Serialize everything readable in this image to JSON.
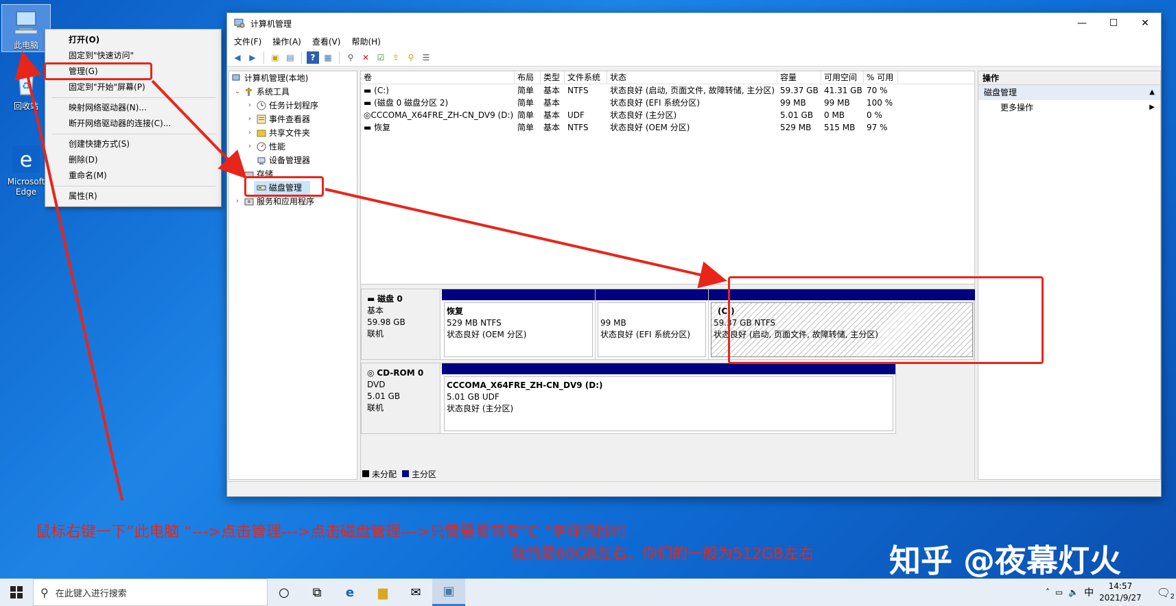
{
  "desktop": {
    "icons": [
      {
        "label": "此电脑"
      },
      {
        "label": "回收站"
      },
      {
        "label": "Microsoft Edge"
      }
    ]
  },
  "context_menu": {
    "items": [
      {
        "label": "打开(O)"
      },
      {
        "label": "固定到\"快速访问\""
      },
      {
        "label": "管理(G)"
      },
      {
        "label": "固定到\"开始\"屏幕(P)"
      },
      {
        "label": "映射网络驱动器(N)..."
      },
      {
        "label": "断开网络驱动器的连接(C)..."
      },
      {
        "label": "创建快捷方式(S)"
      },
      {
        "label": "删除(D)"
      },
      {
        "label": "重命名(M)"
      },
      {
        "label": "属性(R)"
      }
    ]
  },
  "window": {
    "title": "计算机管理",
    "controls": {
      "minimize": "—",
      "maximize": "☐",
      "close": "✕"
    },
    "menu": [
      "文件(F)",
      "操作(A)",
      "查看(V)",
      "帮助(H)"
    ]
  },
  "tree": {
    "root": "计算机管理(本地)",
    "system_tools": "系统工具",
    "task_scheduler": "任务计划程序",
    "event_viewer": "事件查看器",
    "shared_folders": "共享文件夹",
    "performance": "性能",
    "device_manager": "设备管理器",
    "storage": "存储",
    "disk_management": "磁盘管理",
    "services": "服务和应用程序"
  },
  "volume_table": {
    "headers": [
      "卷",
      "布局",
      "类型",
      "文件系统",
      "状态",
      "容量",
      "可用空间",
      "% 可用"
    ],
    "rows": [
      [
        "(C:)",
        "简单",
        "基本",
        "NTFS",
        "状态良好 (启动, 页面文件, 故障转储, 主分区)",
        "59.37 GB",
        "41.31 GB",
        "70 %"
      ],
      [
        "(磁盘 0 磁盘分区 2)",
        "简单",
        "基本",
        "",
        "状态良好 (EFI 系统分区)",
        "99 MB",
        "99 MB",
        "100 %"
      ],
      [
        "CCCOMA_X64FRE_ZH-CN_DV9 (D:)",
        "简单",
        "基本",
        "UDF",
        "状态良好 (主分区)",
        "5.01 GB",
        "0 MB",
        "0 %"
      ],
      [
        "恢复",
        "简单",
        "基本",
        "NTFS",
        "状态良好 (OEM 分区)",
        "529 MB",
        "515 MB",
        "97 %"
      ]
    ]
  },
  "disks": {
    "disk0": {
      "name": "磁盘 0",
      "type": "基本",
      "size": "59.98 GB",
      "status": "联机",
      "partitions": [
        {
          "name": "恢复",
          "size": "529 MB NTFS",
          "status": "状态良好 (OEM 分区)"
        },
        {
          "name": "",
          "size": "99 MB",
          "status": "状态良好 (EFI 系统分区)"
        },
        {
          "name": "(C:)",
          "size": "59.37 GB NTFS",
          "status": "状态良好 (启动, 页面文件, 故障转储, 主分区)"
        }
      ]
    },
    "cdrom0": {
      "name": "CD-ROM 0",
      "type": "DVD",
      "size": "5.01 GB",
      "status": "联机",
      "partitions": [
        {
          "name": "CCCOMA_X64FRE_ZH-CN_DV9  (D:)",
          "size": "5.01 GB UDF",
          "status": "状态良好 (主分区)"
        }
      ]
    },
    "legend": [
      "未分配",
      "主分区"
    ]
  },
  "actions": {
    "header": "操作",
    "section": "磁盘管理",
    "more": "更多操作"
  },
  "annotations": {
    "line1": "鼠标右键一下”此电脑 “--->点击管理--->点击磁盘管理--->只需要看带有”C “字样的即可",
    "line2": "我的是60GB左右，你们的一般为512GB左右",
    "brand": "知乎 @夜幕灯火"
  },
  "taskbar": {
    "search_placeholder": "在此键入进行搜索",
    "time": "14:57",
    "date": "2021/9/27",
    "ime": "中",
    "notifications": "2"
  },
  "colors": {
    "accent": "#000080",
    "annotation": "#e8251a",
    "desktop": "#1d84e6"
  }
}
